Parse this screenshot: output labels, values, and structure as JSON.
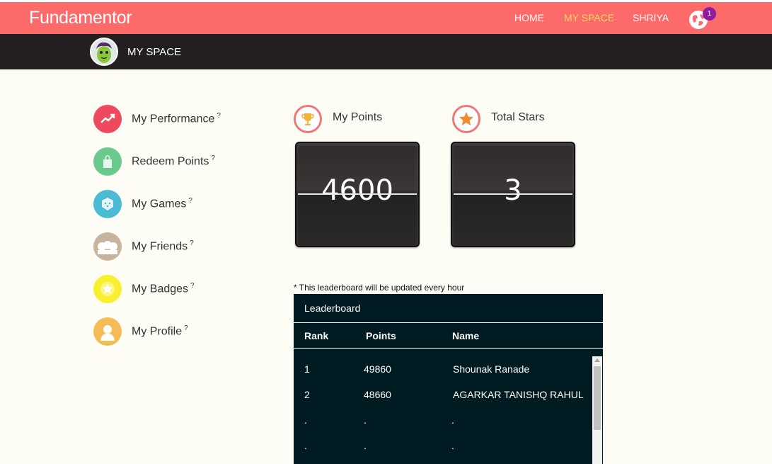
{
  "header": {
    "logo": "Fundamentor",
    "nav": [
      {
        "label": "HOME"
      },
      {
        "label": "MY SPACE"
      },
      {
        "label": "SHRIYA"
      }
    ],
    "notification_count": "1"
  },
  "subheader": {
    "title": "MY SPACE"
  },
  "menu": [
    {
      "label": "My Performance",
      "q": "?",
      "icon": "trend-up-icon",
      "color": "#ee4a5e"
    },
    {
      "label": "Redeem Points",
      "q": "?",
      "icon": "shopping-bag-icon",
      "color": "#6ac98d"
    },
    {
      "label": "My Games",
      "q": "?",
      "icon": "dice-icon",
      "color": "#4bbad3"
    },
    {
      "label": "My Friends",
      "q": "?",
      "icon": "friends-icon",
      "color": "#c6b49e"
    },
    {
      "label": "My Badges",
      "q": "?",
      "icon": "star-badge-icon",
      "color": "#f7ef2f"
    },
    {
      "label": "My Profile",
      "q": "?",
      "icon": "profile-icon",
      "color": "#f5bc56"
    }
  ],
  "stats": {
    "points": {
      "label": "My Points",
      "value": "4600",
      "icon": "trophy-icon"
    },
    "stars": {
      "label": "Total Stars",
      "value": "3",
      "icon": "star-icon"
    }
  },
  "leaderboard": {
    "note": "* This leaderboard will be updated every hour",
    "title": "Leaderboard",
    "columns": [
      "Rank",
      "Points",
      "Name"
    ],
    "rows": [
      [
        "1",
        "49860",
        "Shounak Ranade"
      ],
      [
        "2",
        "48660",
        "AGARKAR TANISHQ RAHUL"
      ],
      [
        ".",
        ".",
        "."
      ],
      [
        ".",
        ".",
        "."
      ]
    ]
  },
  "colors": {
    "navbar": "#fd6a6a",
    "active_nav": "#ffd966",
    "subbar": "#231f20",
    "leaderboard_bg": "#011b22"
  }
}
